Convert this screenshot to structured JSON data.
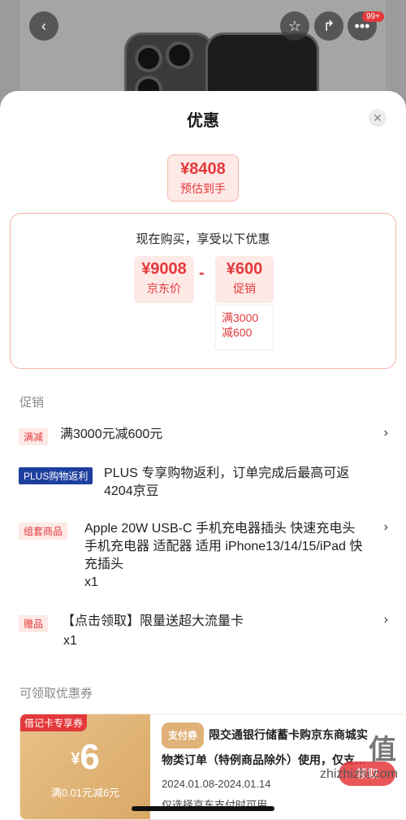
{
  "header": {
    "cart_badge": "99+",
    "icons": [
      "back-icon",
      "star-icon",
      "share-icon",
      "more-icon"
    ]
  },
  "sheet": {
    "title": "优惠",
    "estimate": {
      "price": "¥8408",
      "label": "预估到手"
    },
    "calc": {
      "title": "现在购买，享受以下优惠",
      "base": {
        "price": "¥9008",
        "label": "京东价"
      },
      "minus": "-",
      "discount": {
        "price": "¥600",
        "label": "促销"
      },
      "rule_line1": "满3000",
      "rule_line2": "减600"
    }
  },
  "promotions": {
    "section_title": "促销",
    "items": [
      {
        "tag": "满减",
        "text_lines": [
          "满3000元减600元"
        ],
        "qty": ""
      },
      {
        "tag": "PLUS购物返利",
        "text_lines": [
          "PLUS 专享购物返利，订单完成后最高可返",
          "4204京豆"
        ],
        "qty": ""
      },
      {
        "tag": "组套商品",
        "text_lines": [
          "Apple 20W USB-C 手机充电器插头 快速充电头",
          "手机充电器 适配器 适用 iPhone13/14/15/iPad 快",
          "充插头"
        ],
        "qty": "x1"
      },
      {
        "tag": "赠品",
        "text_lines": [
          "【点击领取】限量送超大流量卡"
        ],
        "qty": "x1"
      }
    ]
  },
  "coupons": {
    "section_title": "可领取优惠券",
    "items": [
      {
        "tag": "借记卡专享券",
        "currency": "¥",
        "amount": "6",
        "condition": "满0.01元减6元",
        "pay_tag": "支付券",
        "desc_line1": "限交通银行储蓄卡购京东商城实",
        "desc_line2": "物类订单（特例商品除外）使用，仅支…",
        "date": "2024.01.08-2024.01.14",
        "note": "仅选择京东支付时可用",
        "claim_label": "领取"
      }
    ]
  },
  "watermark": {
    "logo": "值",
    "site": "zhizhizhi.com"
  }
}
